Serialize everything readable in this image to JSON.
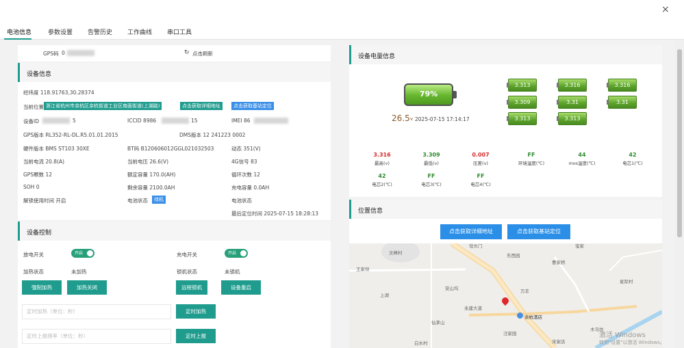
{
  "tabs": [
    "电池信息",
    "参数设置",
    "告警历史",
    "工作曲线",
    "串口工具"
  ],
  "close_icon": "×",
  "gps": {
    "label": "GPS码",
    "value": "0",
    "refresh_label": "点击刷新"
  },
  "device_info": {
    "title": "设备信息",
    "coords": "经纬度 118.91763,30.28374",
    "location_label": "当前位置",
    "location_value": "浙江省杭州市余杭区余杭街道工业区南面街道(上湖路)",
    "btn_address": "点击获取详细地址",
    "btn_base": "点击获取基站定位",
    "rows": [
      [
        "设备ID",
        "ICCID 8986",
        "IMEI 86"
      ],
      [
        "GPS版本 RL352-RL-DL.R5.01.01.2015",
        "",
        "DMS版本 12 241223 0002"
      ],
      [
        "硬件版本 BMS ST103 30XE",
        "BT码 B120606012GGL021032503",
        "动态 351(V)"
      ],
      [
        "当前电流 20.8(A)",
        "当前电压 26.6(V)",
        "4G信号 83"
      ],
      [
        "GPS颗数 12",
        "额定容量 170.0(AH)",
        "循环次数 12"
      ],
      [
        "SOH 0",
        "剩余容量 2100.0AH",
        "充电容量 0.0AH"
      ],
      [
        "解锁使用时间 开启",
        "电池状态",
        ""
      ]
    ],
    "id_suffix": "5",
    "iccid_suffix": "15",
    "battery_status_badge": "待机",
    "runtime_status_label": "电池状态",
    "last_location": "最后定位时间 2025-07-15 18:28:13"
  },
  "device_control": {
    "title": "设备控制",
    "discharge_label": "放电开关",
    "discharge_state": "开启",
    "charge_label": "充电开关",
    "charge_state": "开启",
    "heat_status_label": "加热状态",
    "heat_status_value": "未加热",
    "lock_status_label": "锁机状态",
    "lock_status_value": "未锁机",
    "btn_heat_on": "强制加热",
    "btn_heat_off": "加热关闭",
    "btn_lock": "远程锁机",
    "btn_reboot": "设备重启",
    "timed_heat_placeholder": "定时加热（单位：秒）",
    "btn_timed_heat": "定时加热",
    "timed_upload_placeholder": "定时上报频率（单位：秒）",
    "btn_timed_upload": "定时上报"
  },
  "battery_panel": {
    "title": "设备电量信息",
    "soc": "79%",
    "voltage": "26.5",
    "voltage_unit": "v",
    "timestamp": "2025-07-15 17:14:17",
    "cells": [
      "3.313",
      "3.316",
      "3.316",
      "3.309",
      "3.31",
      "3.31",
      "3.313",
      "3.313"
    ],
    "stats": [
      {
        "value": "3.316",
        "label": "最高(v)",
        "color": "#d62e2e"
      },
      {
        "value": "3.309",
        "label": "最低(v)",
        "color": "#2f8a2f"
      },
      {
        "value": "0.007",
        "label": "压差(v)",
        "color": "#d62e2e"
      },
      {
        "value": "FF",
        "label": "环境温度(℃)",
        "color": "#2f8a2f"
      },
      {
        "value": "44",
        "label": "mos温度(℃)",
        "color": "#2f8a2f"
      },
      {
        "value": "42",
        "label": "电芯1(℃)",
        "color": "#2f8a2f"
      },
      {
        "value": "42",
        "label": "电芯2(℃)",
        "color": "#2f8a2f"
      },
      {
        "value": "FF",
        "label": "电芯3(℃)",
        "color": "#2f8a2f"
      },
      {
        "value": "FF",
        "label": "电芯4(℃)",
        "color": "#2f8a2f"
      }
    ]
  },
  "location_panel": {
    "title": "位置信息",
    "btn_address": "点击获取详细地址",
    "btn_base": "点击获取基站定位",
    "map_labels": [
      "埝头门",
      "文峰村",
      "王家坝",
      "仙茅山",
      "白水村",
      "宝家",
      "东西园",
      "曹家桥",
      "永建大道",
      "余杭酒店",
      "安山坞",
      "万丰",
      "汪家园",
      "宋家店",
      "木马坊",
      "上湖",
      "星际村"
    ],
    "watermark_line1": "激活 Windows",
    "watermark_line2": "转到\"设置\"以激活 Windows。"
  },
  "colors": {
    "accent": "#1f9c8e",
    "blue": "#2b8fe8",
    "red": "#d62e2e",
    "green": "#2f8a2f"
  }
}
